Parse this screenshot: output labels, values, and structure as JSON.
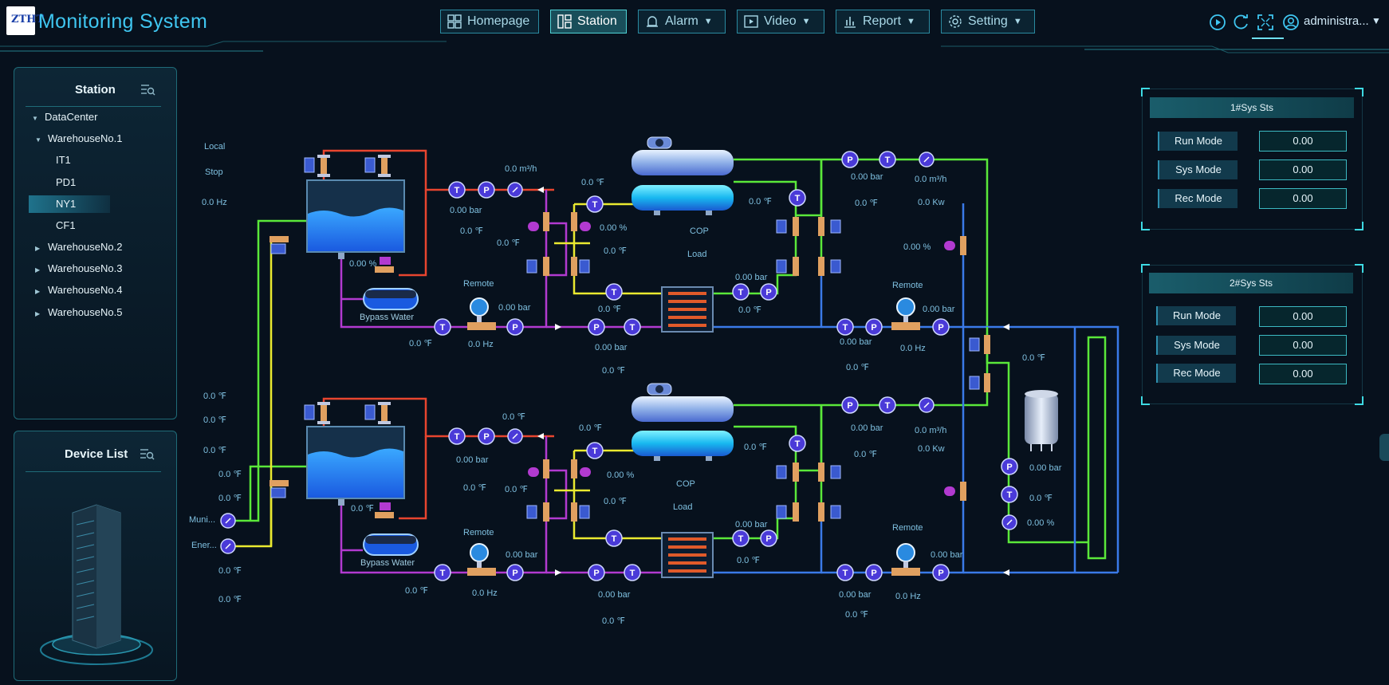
{
  "header": {
    "app_title": "Monitoring System",
    "logo_text": "ZTHT",
    "nav": [
      {
        "label": "Homepage",
        "icon": "grid-icon",
        "active": false,
        "has_menu": false
      },
      {
        "label": "Station",
        "icon": "layout-icon",
        "active": true,
        "has_menu": false
      },
      {
        "label": "Alarm",
        "icon": "bell-icon",
        "active": false,
        "has_menu": true
      },
      {
        "label": "Video",
        "icon": "play-icon",
        "active": false,
        "has_menu": true
      },
      {
        "label": "Report",
        "icon": "bar-chart-icon",
        "active": false,
        "has_menu": true
      },
      {
        "label": "Setting",
        "icon": "gear-icon",
        "active": false,
        "has_menu": true
      }
    ],
    "user": "administra..."
  },
  "station_panel": {
    "title": "Station",
    "tree": [
      {
        "label": "DataCenter",
        "level": 0,
        "expanded": true
      },
      {
        "label": "WarehouseNo.1",
        "level": 1,
        "expanded": true
      },
      {
        "label": "IT1",
        "level": 2
      },
      {
        "label": "PD1",
        "level": 2
      },
      {
        "label": "NY1",
        "level": 2,
        "selected": true
      },
      {
        "label": "CF1",
        "level": 2
      },
      {
        "label": "WarehouseNo.2",
        "level": 1,
        "expanded": false
      },
      {
        "label": "WarehouseNo.3",
        "level": 1,
        "expanded": false
      },
      {
        "label": "WarehouseNo.4",
        "level": 1,
        "expanded": false
      },
      {
        "label": "WarehouseNo.5",
        "level": 1,
        "expanded": false
      }
    ]
  },
  "device_panel": {
    "title": "Device List"
  },
  "diagram": {
    "left_status": [
      "Local",
      "Stop",
      "0.0 Hz"
    ],
    "left_temps": [
      "0.0 ℉",
      "0.0 ℉",
      "0.0 ℉",
      "0.0 ℉",
      "0.0 ℉",
      "0.0 ℉",
      "0.0 ℉"
    ],
    "meter_labels": [
      "Muni...",
      "Ener..."
    ],
    "unit1": {
      "flow": "0.0 m³/h",
      "temp_top": "0.0 ℉",
      "bar1": "0.00 bar",
      "temp1": "0.0 ℉",
      "temp2": "0.0 ℉",
      "pct1": "0.00 %",
      "temp3": "0.0 ℉",
      "bypass_pct": "0.00 %",
      "bypass": "Bypass Water",
      "remote": "Remote",
      "pump_bar": "0.00 bar",
      "pump_temp": "0.0 ℉",
      "pump_hz": "0.0 Hz",
      "cop": "COP",
      "load": "Load",
      "temp4": "0.0 ℉",
      "evap_temp": "0.0 ℉",
      "hx_bar": "0.00 bar",
      "hx_temp": "0.0 ℉",
      "return_bar": "0.00 bar",
      "return_temp": "0.0 ℉",
      "cw_bar": "0.00 bar",
      "cw_temp": "0.0 ℉",
      "cw_flow": "0.0 m³/h",
      "kw": "0.0 Kw",
      "valve_pct": "0.00 %",
      "remote_r": "Remote",
      "rp_bar": "0.00 bar",
      "rp_bar2": "0.00 bar",
      "rp_temp": "0.0 ℉",
      "rp_hz": "0.0 Hz"
    },
    "unit2": {
      "temp_top": "0.0 ℉",
      "bar1": "0.00 bar",
      "temp1": "0.0 ℉",
      "temp2": "0.0 ℉",
      "temp_a": "0.0 ℉",
      "pct1": "0.00 %",
      "temp3": "0.0 ℉",
      "level_temp": "0.0 ℉",
      "bypass": "Bypass Water",
      "remote": "Remote",
      "pump_bar": "0.00 bar",
      "pump_temp": "0.0 ℉",
      "pump_hz": "0.0 Hz",
      "cop": "COP",
      "load": "Load",
      "temp4": "0.0 ℉",
      "hx_bar": "0.00 bar",
      "hx_temp": "0.0 ℉",
      "return_bar": "0.00 bar",
      "return_temp": "0.0 ℉",
      "cw_bar": "0.00 bar",
      "cw_temp": "0.0 ℉",
      "cw_flow": "0.0 m³/h",
      "kw": "0.0 Kw",
      "remote_r": "Remote",
      "rp_bar": "0.00 bar",
      "rp_bar2": "0.00 bar",
      "rp_temp": "0.0 ℉",
      "rp_hz": "0.0 Hz"
    },
    "right_loop": {
      "temp": "0.0 ℉",
      "bar": "0.00 bar",
      "temp2": "0.0 ℉",
      "pct": "0.00 %"
    },
    "badges": {
      "temp": "T",
      "pressure": "P"
    }
  },
  "sys1": {
    "title": "1#Sys Sts",
    "rows": [
      {
        "label": "Run Mode",
        "value": "0.00"
      },
      {
        "label": "Sys Mode",
        "value": "0.00"
      },
      {
        "label": "Rec Mode",
        "value": "0.00"
      }
    ]
  },
  "sys2": {
    "title": "2#Sys Sts",
    "rows": [
      {
        "label": "Run Mode",
        "value": "0.00"
      },
      {
        "label": "Sys Mode",
        "value": "0.00"
      },
      {
        "label": "Rec Mode",
        "value": "0.00"
      }
    ]
  },
  "colors": {
    "red_pipe": "#e8452f",
    "magenta_pipe": "#b23ad0",
    "yellow_pipe": "#eaea30",
    "green_pipe": "#5ae83a",
    "blue_pipe": "#3a7ae8",
    "accent": "#3fc6f0"
  }
}
